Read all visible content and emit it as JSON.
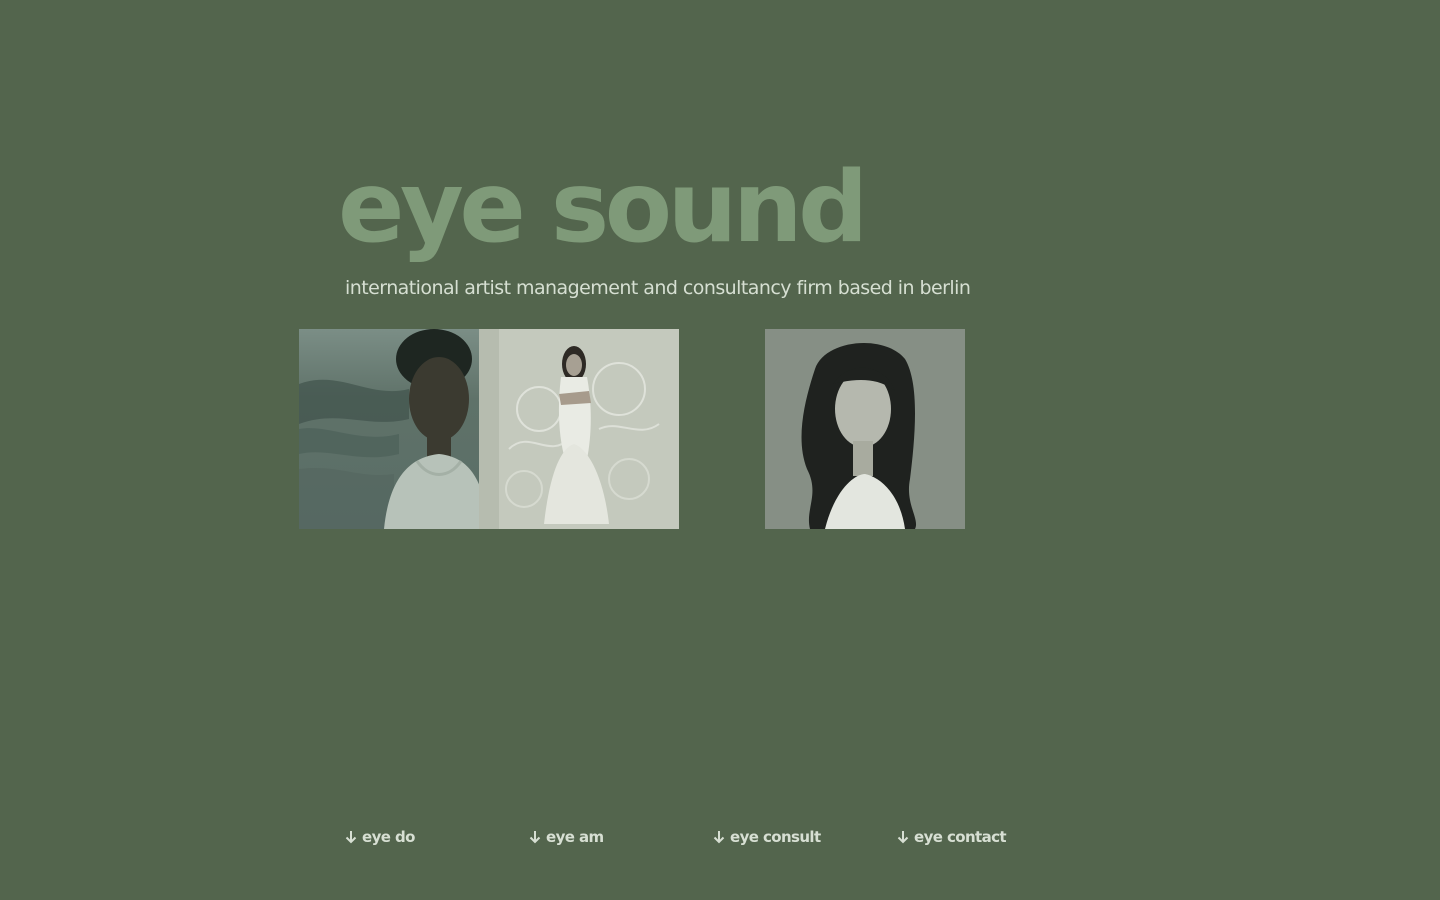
{
  "brand": {
    "logo": "eye sound",
    "tagline": "international artist management and consultancy firm based in berlin"
  },
  "colors": {
    "background": "#53654d",
    "logo": "#7f9a79",
    "text": "#d6dfd2"
  },
  "nav": {
    "items": [
      {
        "label": "eye do",
        "icon": "arrow-down-icon"
      },
      {
        "label": "eye am",
        "icon": "arrow-down-icon"
      },
      {
        "label": "eye consult",
        "icon": "arrow-down-icon"
      },
      {
        "label": "eye contact",
        "icon": "arrow-down-icon"
      }
    ]
  }
}
